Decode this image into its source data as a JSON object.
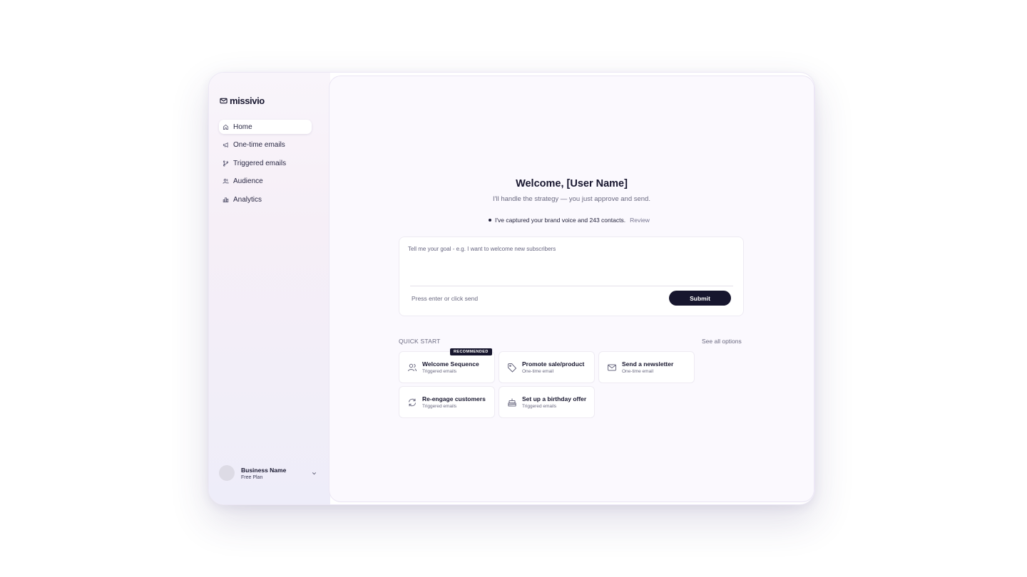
{
  "app": {
    "logo_text": "missivio"
  },
  "sidebar": {
    "items": [
      {
        "label": "Home",
        "icon": "home-icon",
        "active": true
      },
      {
        "label": "One-time emails",
        "icon": "megaphone-icon"
      },
      {
        "label": "Triggered emails",
        "icon": "branch-icon"
      },
      {
        "label": "Audience",
        "icon": "users-icon"
      },
      {
        "label": "Analytics",
        "icon": "bar-chart-icon"
      }
    ],
    "account": {
      "name": "Business Name",
      "plan": "Free Plan"
    }
  },
  "main": {
    "title": "Welcome, [User Name]",
    "subtitle": "I'll handle the strategy — you just approve and send.",
    "status": {
      "text": "I've captured your brand voice and 243 contacts.",
      "link": "Review"
    },
    "prompt": {
      "placeholder": "Tell me your goal - e.g. I want to welcome new subscribers",
      "value": "",
      "hint": "Press enter or click send",
      "submit_label": "Submit"
    },
    "quick_start": {
      "label": "QUICK START",
      "see_all": "See all options",
      "cards": [
        {
          "title": "Welcome Sequence",
          "sub": "Triggered emails",
          "icon": "users-icon",
          "badge": "RECOMMENDED"
        },
        {
          "title": "Promote sale/product",
          "sub": "One-time email",
          "icon": "tag-icon"
        },
        {
          "title": "Send a newsletter",
          "sub": "One-time email",
          "icon": "mail-icon"
        },
        {
          "title": "Re-engage customers",
          "sub": "Triggered emails",
          "icon": "refresh-icon"
        },
        {
          "title": "Set up a birthday offer",
          "sub": "Triggered emails",
          "icon": "cake-icon"
        }
      ]
    }
  }
}
